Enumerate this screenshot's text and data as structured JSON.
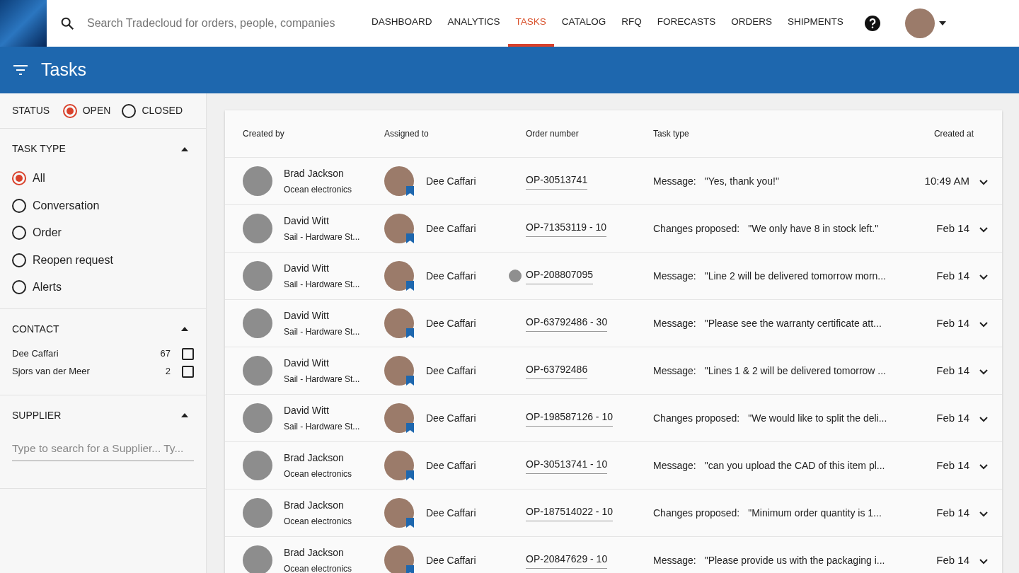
{
  "search": {
    "placeholder": "Search Tradecloud for orders, people, companies"
  },
  "nav": [
    {
      "label": "DASHBOARD",
      "selected": false
    },
    {
      "label": "ANALYTICS",
      "selected": false
    },
    {
      "label": "TASKS",
      "selected": true
    },
    {
      "label": "CATALOG",
      "selected": false
    },
    {
      "label": "RFQ",
      "selected": false
    },
    {
      "label": "FORECASTS",
      "selected": false
    },
    {
      "label": "ORDERS",
      "selected": false
    },
    {
      "label": "SHIPMENTS",
      "selected": false
    }
  ],
  "page_title": "Tasks",
  "filters": {
    "status": {
      "label": "STATUS",
      "options": [
        {
          "label": "OPEN",
          "selected": true
        },
        {
          "label": "CLOSED",
          "selected": false
        }
      ]
    },
    "task_type": {
      "label": "TASK TYPE",
      "expanded": true,
      "options": [
        {
          "label": "All",
          "selected": true
        },
        {
          "label": "Conversation",
          "selected": false
        },
        {
          "label": "Order",
          "selected": false
        },
        {
          "label": "Reopen request",
          "selected": false
        },
        {
          "label": "Alerts",
          "selected": false
        }
      ]
    },
    "contact": {
      "label": "CONTACT",
      "expanded": true,
      "items": [
        {
          "name": "Dee Caffari",
          "count": "67",
          "checked": false
        },
        {
          "name": "Sjors van der Meer",
          "count": "2",
          "checked": false
        }
      ]
    },
    "supplier": {
      "label": "SUPPLIER",
      "expanded": true,
      "placeholder": "Type to search for a Supplier... Ty..."
    }
  },
  "table": {
    "columns": [
      "Created by",
      "Assigned to",
      "Order number",
      "Task type",
      "Created at"
    ],
    "rows": [
      {
        "created_by": "Brad Jackson",
        "company": "Ocean electronics",
        "assigned_to": "Dee Caffari",
        "order": "OP-30513741",
        "unread": false,
        "type": "Message:",
        "text": "\"Yes, thank you!\"",
        "created_at": "10:49 AM"
      },
      {
        "created_by": "David Witt",
        "company": "Sail - Hardware St...",
        "assigned_to": "Dee Caffari",
        "order": "OP-71353119 - 10",
        "unread": false,
        "type": "Changes proposed:",
        "text": "\"We only have 8 in stock left.\"",
        "created_at": "Feb 14"
      },
      {
        "created_by": "David Witt",
        "company": "Sail - Hardware St...",
        "assigned_to": "Dee Caffari",
        "order": "OP-208807095",
        "unread": true,
        "type": "Message:",
        "text": "\"Line 2 will be delivered tomorrow morn...",
        "created_at": "Feb 14"
      },
      {
        "created_by": "David Witt",
        "company": "Sail - Hardware St...",
        "assigned_to": "Dee Caffari",
        "order": "OP-63792486 - 30",
        "unread": false,
        "type": "Message:",
        "text": "\"Please see the warranty certificate att...",
        "created_at": "Feb 14"
      },
      {
        "created_by": "David Witt",
        "company": "Sail - Hardware St...",
        "assigned_to": "Dee Caffari",
        "order": "OP-63792486",
        "unread": false,
        "type": "Message:",
        "text": "\"Lines 1 & 2 will be delivered tomorrow ...",
        "created_at": "Feb 14"
      },
      {
        "created_by": "David Witt",
        "company": "Sail - Hardware St...",
        "assigned_to": "Dee Caffari",
        "order": "OP-198587126 - 10",
        "unread": false,
        "type": "Changes proposed:",
        "text": "\"We would like to split the deli...",
        "created_at": "Feb 14"
      },
      {
        "created_by": "Brad Jackson",
        "company": "Ocean electronics",
        "assigned_to": "Dee Caffari",
        "order": "OP-30513741 - 10",
        "unread": false,
        "type": "Message:",
        "text": "\"can you upload the CAD of this item pl...",
        "created_at": "Feb 14"
      },
      {
        "created_by": "Brad Jackson",
        "company": "Ocean electronics",
        "assigned_to": "Dee Caffari",
        "order": "OP-187514022 - 10",
        "unread": false,
        "type": "Changes proposed:",
        "text": "\"Minimum order quantity is 1...",
        "created_at": "Feb 14"
      },
      {
        "created_by": "Brad Jackson",
        "company": "Ocean electronics",
        "assigned_to": "Dee Caffari",
        "order": "OP-20847629 - 10",
        "unread": false,
        "type": "Message:",
        "text": "\"Please provide us with the packaging i...",
        "created_at": "Feb 14"
      }
    ]
  }
}
